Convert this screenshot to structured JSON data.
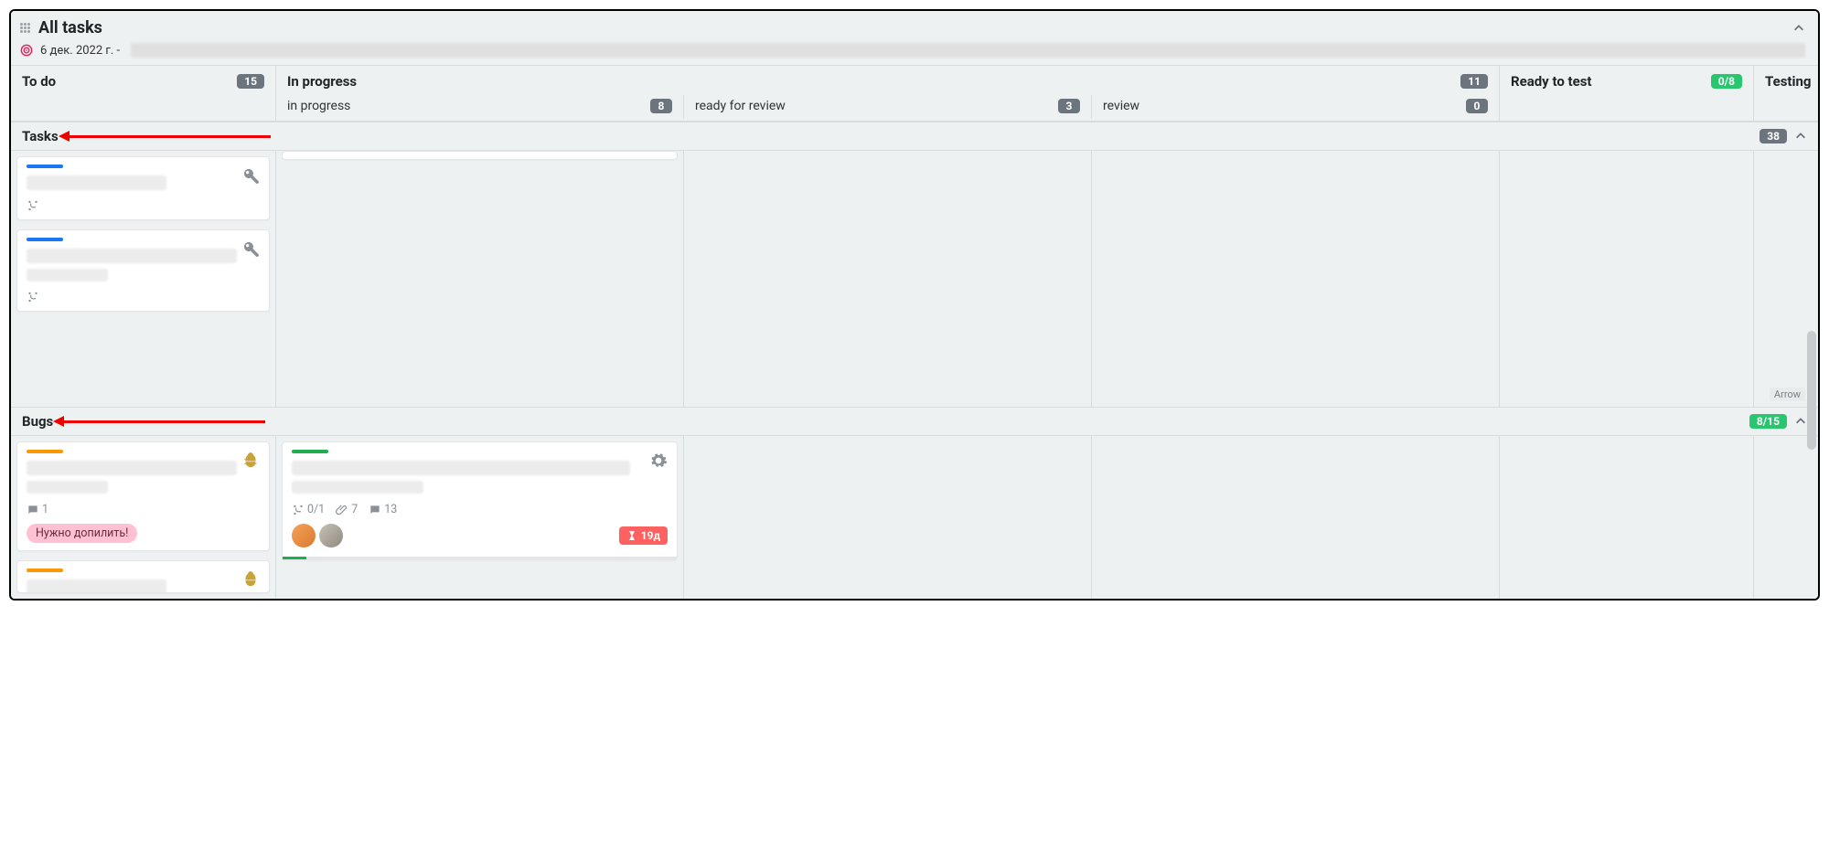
{
  "header": {
    "title": "All tasks",
    "sprint_date": "6 дек. 2022 г. -"
  },
  "columns": {
    "todo": {
      "title": "To do",
      "count": "15"
    },
    "inprog": {
      "title": "In progress",
      "count": "11"
    },
    "ready": {
      "title": "Ready to test",
      "count": "0/8"
    },
    "testing": {
      "title": "Testing"
    }
  },
  "subcols": {
    "inprogress": {
      "label": "in progress",
      "count": "8"
    },
    "readyrev": {
      "label": "ready for review",
      "count": "3"
    },
    "review": {
      "label": "review",
      "count": "0"
    }
  },
  "swimlanes": {
    "tasks": {
      "title": "Tasks",
      "count": "38"
    },
    "bugs": {
      "title": "Bugs",
      "count": "8/15"
    }
  },
  "cards": {
    "bug_todo_1": {
      "comments": "1",
      "tag": "Нужно допилить!"
    },
    "bug_inprog_1": {
      "subtasks": "0/1",
      "attachments": "7",
      "comments": "13",
      "due": "19д"
    }
  },
  "annotation": {
    "arrow_label": "Arrow"
  }
}
